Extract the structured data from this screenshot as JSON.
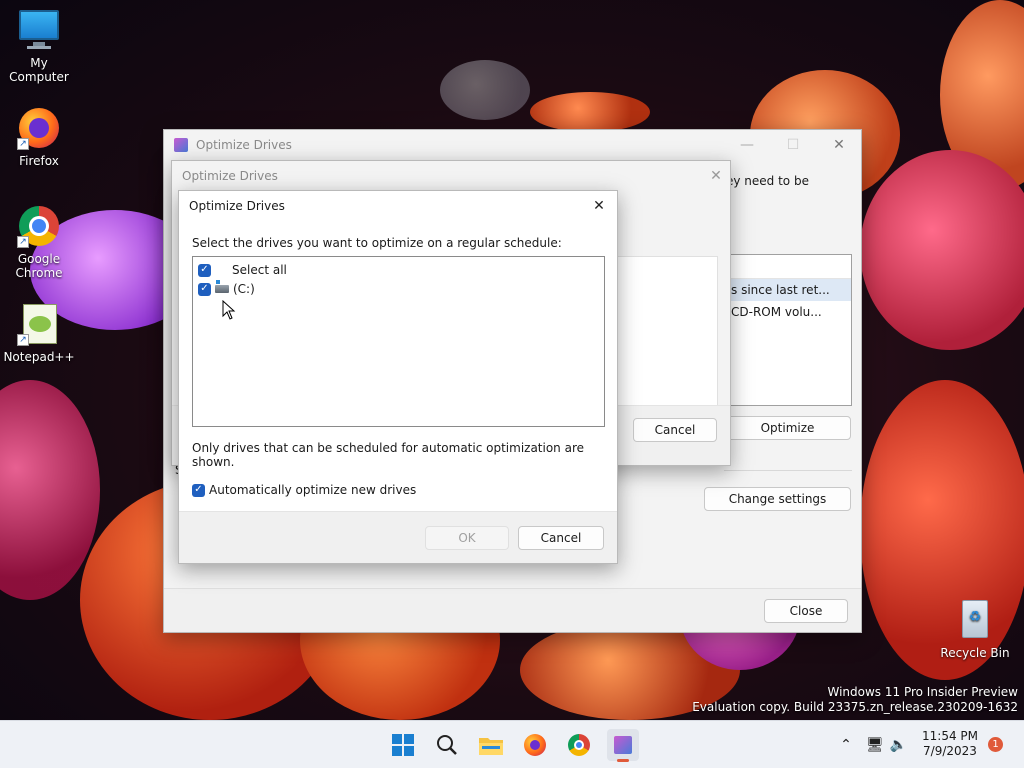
{
  "desktop": {
    "icons": [
      {
        "label": "My Computer"
      },
      {
        "label": "Firefox"
      },
      {
        "label": "Google Chrome"
      },
      {
        "label": "Notepad++"
      },
      {
        "label": "Recycle Bin"
      }
    ],
    "watermark": {
      "line1": "Windows 11 Pro Insider Preview",
      "line2": "Evaluation copy. Build 23375.zn_release.230209-1632"
    }
  },
  "main_window": {
    "title": "Optimize Drives",
    "partial_text": "ey need to be",
    "list_rows": [
      "s since last ret...",
      "CD-ROM volu..."
    ],
    "optimize_label": "Optimize",
    "change_settings_label": "Change settings",
    "close_label": "Close",
    "side_letter": "S"
  },
  "middle_dialog": {
    "title": "Optimize Drives",
    "cancel_label": "Cancel"
  },
  "front_dialog": {
    "title": "Optimize Drives",
    "instruction": "Select the drives you want to optimize on a regular schedule:",
    "drives": [
      {
        "label": "Select all",
        "checked": true
      },
      {
        "label": "(C:)",
        "checked": true
      }
    ],
    "note": "Only drives that can be scheduled for automatic optimization are shown.",
    "auto_label": "Automatically optimize new drives",
    "ok_label": "OK",
    "cancel_label": "Cancel"
  },
  "taskbar": {
    "time": "11:54 PM",
    "date": "7/9/2023",
    "notification_count": "1"
  },
  "colors": {
    "accent": "#1f5fbf",
    "taskbar_bg": "#eef1f6"
  }
}
